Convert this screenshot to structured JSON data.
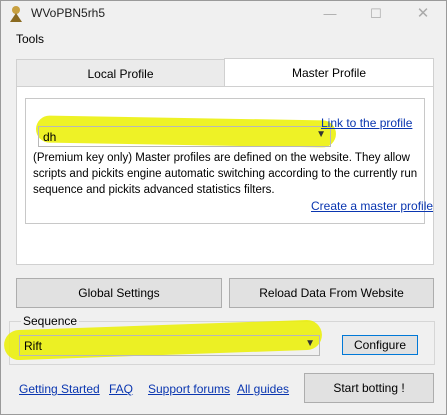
{
  "window": {
    "title": "WVoPBN5rh5",
    "min_glyph": "—",
    "max_glyph": "☐",
    "close_glyph": "✕"
  },
  "menu": {
    "tools": "Tools"
  },
  "tabs": [
    {
      "label": "Local Profile",
      "selected": false
    },
    {
      "label": "Master Profile",
      "selected": true
    }
  ],
  "master_profile": {
    "selected_profile": "dh",
    "link_to_profile": "Link to the profile",
    "description": "(Premium key only) Master profiles are defined on the website. They allow scripts and pickits engine automatic switching according to the currently run sequence and pickits advanced statistics filters.",
    "create_link": "Create a master profile"
  },
  "buttons": {
    "global_settings": "Global Settings",
    "reload": "Reload Data From Website",
    "configure": "Configure",
    "start": "Start botting !"
  },
  "sequence": {
    "label": "Sequence",
    "value": "Rift"
  },
  "footer_links": [
    "Getting Started",
    "FAQ",
    "Support forums",
    "All guides"
  ],
  "colors": {
    "highlight": "#ebf000",
    "link": "#0a36b0",
    "focus_border": "#0078d7"
  }
}
